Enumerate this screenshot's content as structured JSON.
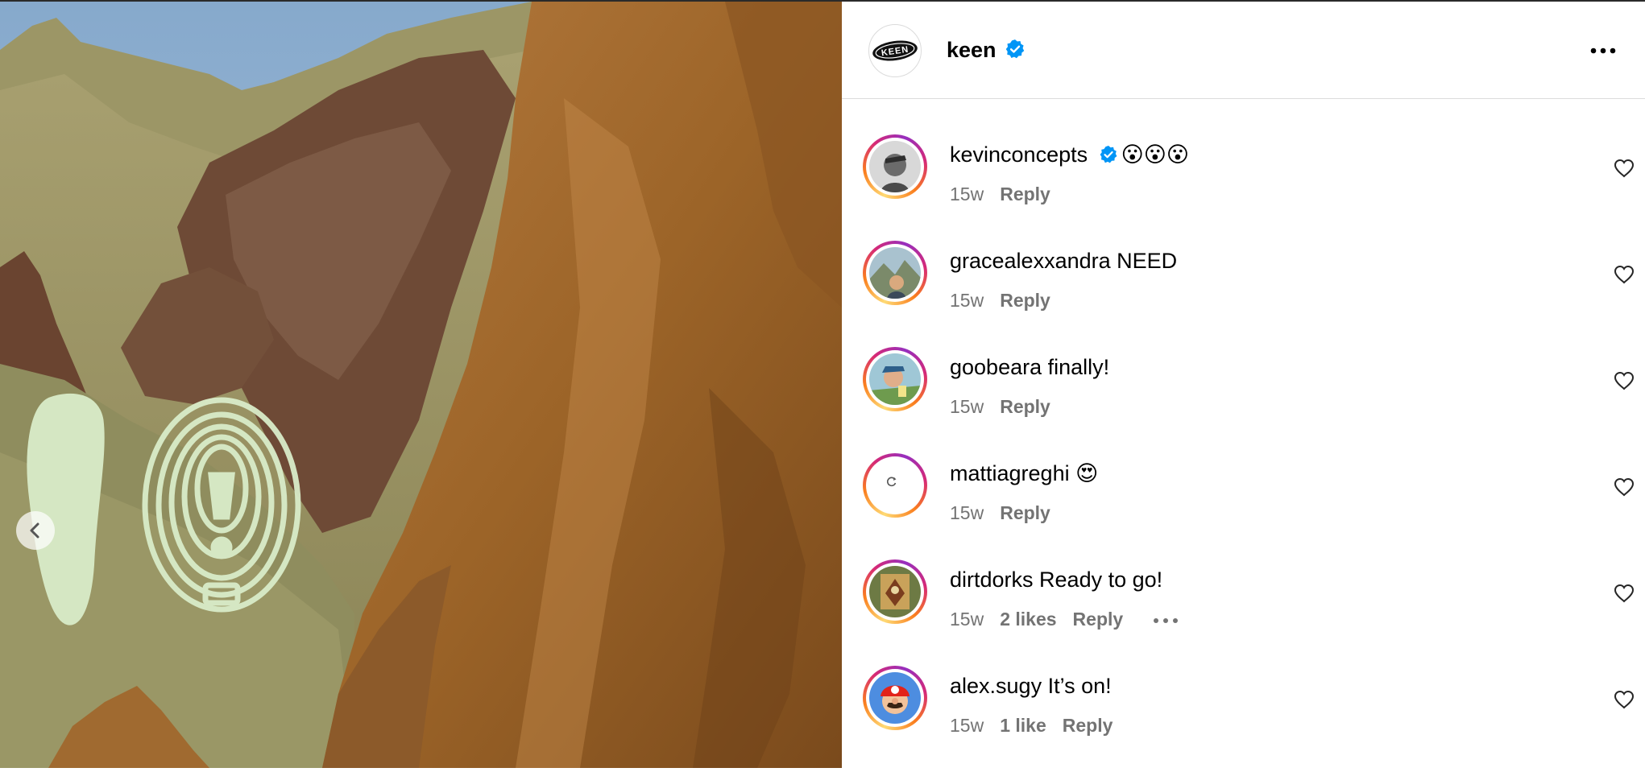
{
  "post": {
    "username": "keen",
    "verified": true,
    "icons": {
      "avatar": "keen-logo",
      "verified": "verified-badge-icon",
      "more": "more-options-icon",
      "prev": "chevron-left-icon"
    }
  },
  "colors": {
    "verified": "#0095f6",
    "meta": "#737373",
    "divider": "#dbdbdb"
  },
  "comments": [
    {
      "username": "kevinconcepts",
      "verified": true,
      "text": "😮😮😮",
      "time": "15w",
      "likes": "",
      "reply": "Reply",
      "more": false
    },
    {
      "username": "gracealexxandra",
      "verified": false,
      "text": "NEED",
      "time": "15w",
      "likes": "",
      "reply": "Reply",
      "more": false
    },
    {
      "username": "goobeara",
      "verified": false,
      "text": "finally!",
      "time": "15w",
      "likes": "",
      "reply": "Reply",
      "more": false
    },
    {
      "username": "mattiagreghi",
      "verified": false,
      "text": "😍",
      "time": "15w",
      "likes": "",
      "reply": "Reply",
      "more": false
    },
    {
      "username": "dirtdorks",
      "verified": false,
      "text": "Ready to go!",
      "time": "15w",
      "likes": "2 likes",
      "reply": "Reply",
      "more": true
    },
    {
      "username": "alex.sugy",
      "verified": false,
      "text": "It’s on!",
      "time": "15w",
      "likes": "1 like",
      "reply": "Reply",
      "more": false
    }
  ]
}
